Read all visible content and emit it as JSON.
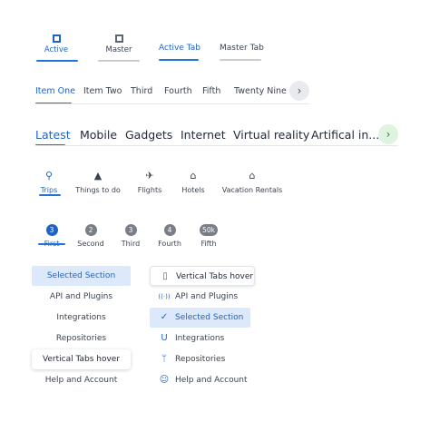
{
  "row1": {
    "tabs": [
      {
        "label": "Active",
        "icon": "square-icon"
      },
      {
        "label": "Master",
        "icon": "square-icon"
      },
      {
        "label": "Active Tab"
      },
      {
        "label": "Master Tab"
      }
    ]
  },
  "row2": {
    "items": [
      "Item One",
      "Item Two",
      "Third",
      "Fourth",
      "Fifth",
      "Twenty Nine"
    ],
    "next_icon": "›"
  },
  "row3": {
    "items": [
      "Latest",
      "Mobile",
      "Gadgets",
      "Internet",
      "Virtual reality",
      "Artifical in..."
    ],
    "next_icon": "›"
  },
  "row4": {
    "items": [
      {
        "label": "Trips",
        "icon": "⚲"
      },
      {
        "label": "Things to do",
        "icon": "▲"
      },
      {
        "label": "Flights",
        "icon": "✈"
      },
      {
        "label": "Hotels",
        "icon": "⌂"
      },
      {
        "label": "Vacation Rentals",
        "icon": "⌂"
      }
    ]
  },
  "row5": {
    "items": [
      {
        "label": "First",
        "badge": "3"
      },
      {
        "label": "Second",
        "badge": "2"
      },
      {
        "label": "Third",
        "badge": "3"
      },
      {
        "label": "Fourth",
        "badge": "4"
      },
      {
        "label": "Fifth",
        "badge": "50k"
      }
    ]
  },
  "left_list": [
    "Selected Section",
    "API and Plugins",
    "Integrations",
    "Repositories",
    "Vertical Tabs hover",
    "Help and Account"
  ],
  "right_list": [
    {
      "label": "Vertical Tabs hover",
      "icon": "▯"
    },
    {
      "label": "API and Plugins",
      "icon": "((·))"
    },
    {
      "label": "Selected Section",
      "icon": "✓"
    },
    {
      "label": "Integrations",
      "icon": "U"
    },
    {
      "label": "Repositories",
      "icon": "ᛘ"
    },
    {
      "label": "Help and Account",
      "icon": "☺"
    }
  ]
}
